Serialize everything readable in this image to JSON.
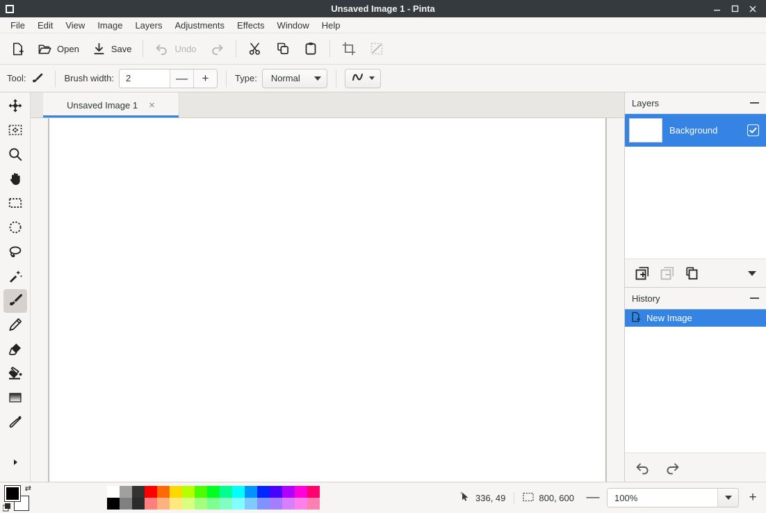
{
  "window": {
    "title": "Unsaved Image 1 - Pinta",
    "app_icon": "pinta-app-icon",
    "controls": {
      "minimize": "minimize-icon",
      "maximize": "maximize-icon",
      "close": "close-icon"
    }
  },
  "menubar": {
    "items": [
      {
        "label": "File"
      },
      {
        "label": "Edit"
      },
      {
        "label": "View"
      },
      {
        "label": "Image"
      },
      {
        "label": "Layers"
      },
      {
        "label": "Adjustments"
      },
      {
        "label": "Effects"
      },
      {
        "label": "Window"
      },
      {
        "label": "Help"
      }
    ]
  },
  "toolbar": {
    "new_label": "",
    "open_label": "Open",
    "save_label": "Save",
    "undo_label": "Undo",
    "redo_label": "",
    "items": [
      {
        "name": "new-image-button",
        "icon": "new-file-icon",
        "label": ""
      },
      {
        "name": "open-button",
        "icon": "open-folder-icon",
        "label": "Open"
      },
      {
        "name": "save-button",
        "icon": "save-download-icon",
        "label": "Save"
      },
      {
        "name": "undo-button",
        "icon": "undo-arrow-icon",
        "label": "Undo",
        "disabled": true
      },
      {
        "name": "redo-button",
        "icon": "redo-arrow-icon",
        "label": "",
        "disabled": true
      },
      {
        "name": "cut-button",
        "icon": "scissors-icon",
        "label": ""
      },
      {
        "name": "copy-button",
        "icon": "copy-icon",
        "label": ""
      },
      {
        "name": "paste-button",
        "icon": "clipboard-paste-icon",
        "label": ""
      },
      {
        "name": "crop-button",
        "icon": "crop-icon",
        "label": "",
        "disabled": true
      },
      {
        "name": "deselect-button",
        "icon": "deselect-icon",
        "label": "",
        "disabled": true
      }
    ]
  },
  "tool_options": {
    "tool_label": "Tool:",
    "tool_icon": "paintbrush-icon",
    "brush_width_label": "Brush width:",
    "brush_width_value": "2",
    "decrease_symbol": "—",
    "increase_symbol": "+",
    "type_label": "Type:",
    "blend_mode_value": "Normal",
    "stroke_style_icon": "curve-stroke-icon"
  },
  "tools": [
    {
      "name": "tool-move-selected",
      "icon": "move-selected-icon",
      "label": "Move Selected",
      "active": false
    },
    {
      "name": "tool-move-selection",
      "icon": "move-selection-icon",
      "label": "Move Selection",
      "active": false
    },
    {
      "name": "tool-zoom",
      "icon": "magnifier-icon",
      "label": "Zoom",
      "active": false
    },
    {
      "name": "tool-pan",
      "icon": "hand-pan-icon",
      "label": "Pan",
      "active": false
    },
    {
      "name": "tool-rectangle-select",
      "icon": "rectangle-select-icon",
      "label": "Rectangle Select",
      "active": false
    },
    {
      "name": "tool-ellipse-select",
      "icon": "ellipse-select-icon",
      "label": "Ellipse Select",
      "active": false
    },
    {
      "name": "tool-lasso-select",
      "icon": "lasso-select-icon",
      "label": "Lasso Select",
      "active": false
    },
    {
      "name": "tool-magic-wand",
      "icon": "magic-wand-icon",
      "label": "Magic Wand Select",
      "active": false
    },
    {
      "name": "tool-paintbrush",
      "icon": "paintbrush-icon",
      "label": "Paintbrush",
      "active": true
    },
    {
      "name": "tool-pencil",
      "icon": "pencil-icon",
      "label": "Pencil",
      "active": false
    },
    {
      "name": "tool-eraser",
      "icon": "eraser-icon",
      "label": "Eraser",
      "active": false
    },
    {
      "name": "tool-paint-bucket",
      "icon": "paint-bucket-icon",
      "label": "Paint Bucket",
      "active": false
    },
    {
      "name": "tool-gradient",
      "icon": "gradient-icon",
      "label": "Gradient",
      "active": false
    },
    {
      "name": "tool-color-picker",
      "icon": "color-picker-icon",
      "label": "Color Picker",
      "active": false
    }
  ],
  "tools_more_icon": "more-tools-arrow-icon",
  "document": {
    "tab_label": "Unsaved Image 1",
    "close_icon": "close-tab-icon"
  },
  "layers_panel": {
    "title": "Layers",
    "minimize_icon": "minimize-panel-icon",
    "rows": [
      {
        "name": "Background",
        "visible": true,
        "selected": true
      }
    ],
    "buttons": [
      {
        "name": "add-layer-button",
        "icon": "add-layer-icon"
      },
      {
        "name": "remove-layer-button",
        "icon": "remove-layer-icon",
        "disabled": true
      },
      {
        "name": "duplicate-layer-button",
        "icon": "duplicate-layer-icon"
      },
      {
        "name": "layer-menu-button",
        "icon": "chevron-down-icon"
      }
    ]
  },
  "history_panel": {
    "title": "History",
    "minimize_icon": "minimize-panel-icon",
    "rows": [
      {
        "label": "New Image",
        "icon": "new-image-icon",
        "selected": true
      }
    ],
    "buttons": [
      {
        "name": "history-undo-button",
        "icon": "undo-arrow-icon"
      },
      {
        "name": "history-redo-button",
        "icon": "redo-arrow-icon"
      }
    ]
  },
  "palette": {
    "primary_color": "#000000",
    "secondary_color": "#ffffff",
    "swap_icon": "swap-colors-icon",
    "reset_icon": "reset-colors-icon",
    "row_top": [
      "#ffffff",
      "#a0a0a0",
      "#333333",
      "#ff0000",
      "#ff6a00",
      "#ffd800",
      "#b6ff00",
      "#4cff00",
      "#00ff21",
      "#00ff90",
      "#00ffff",
      "#0094ff",
      "#0026ff",
      "#4800ff",
      "#b200ff",
      "#ff00dc",
      "#ff006e"
    ],
    "row_bottom": [
      "#000000",
      "#808080",
      "#2b2b2b",
      "#ff7f7f",
      "#ffb27f",
      "#ffe97f",
      "#daff7f",
      "#a5ff7f",
      "#7fff8e",
      "#7fffc4",
      "#7fffff",
      "#7fc9ff",
      "#7f92ff",
      "#a37fff",
      "#d87fff",
      "#ff7fed",
      "#ff7fb2"
    ]
  },
  "statusbar": {
    "cursor_icon": "cursor-position-icon",
    "cursor_position": "336, 49",
    "selection_icon": "selection-size-icon",
    "image_size": "800, 600",
    "zoom_out_symbol": "—",
    "zoom_value": "100%",
    "zoom_in_symbol": "+"
  }
}
